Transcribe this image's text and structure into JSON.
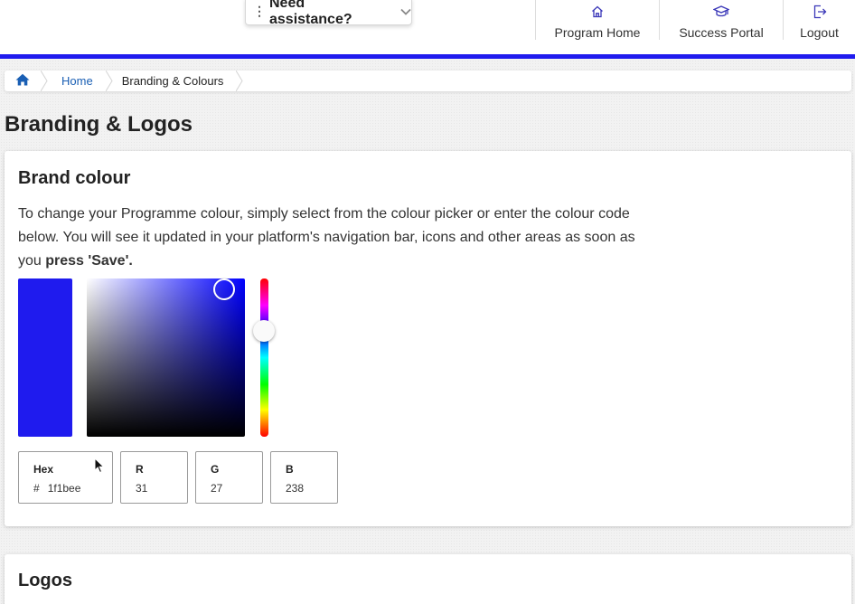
{
  "header": {
    "assist_label": "Need assistance?",
    "nav": [
      {
        "label": "Program Home",
        "icon": "home-icon"
      },
      {
        "label": "Success Portal",
        "icon": "graduation-cap-icon"
      },
      {
        "label": "Logout",
        "icon": "logout-icon"
      }
    ],
    "accent_color": "#1f1bee",
    "icon_color": "#3a37b8"
  },
  "breadcrumb": {
    "home_icon": "home-icon",
    "items": [
      "Home",
      "Branding & Colours"
    ]
  },
  "page_title": "Branding & Logos",
  "brand_colour": {
    "title": "Brand colour",
    "desc_text": "To change your Programme colour, simply select from the colour picker or enter the colour code below. You will see it updated in your platform's navigation bar, icons and other areas as soon as you ",
    "desc_bold": "press 'Save'.",
    "picker": {
      "saturation_pct": 87,
      "value_pct": 93,
      "hue_deg": 241,
      "hue_color": "#0000ff"
    },
    "fields": {
      "hex": {
        "label": "Hex",
        "prefix": "#",
        "value": "1f1bee"
      },
      "r": {
        "label": "R",
        "value": "31"
      },
      "g": {
        "label": "G",
        "value": "27"
      },
      "b": {
        "label": "B",
        "value": "238"
      }
    }
  },
  "logos": {
    "title": "Logos"
  }
}
